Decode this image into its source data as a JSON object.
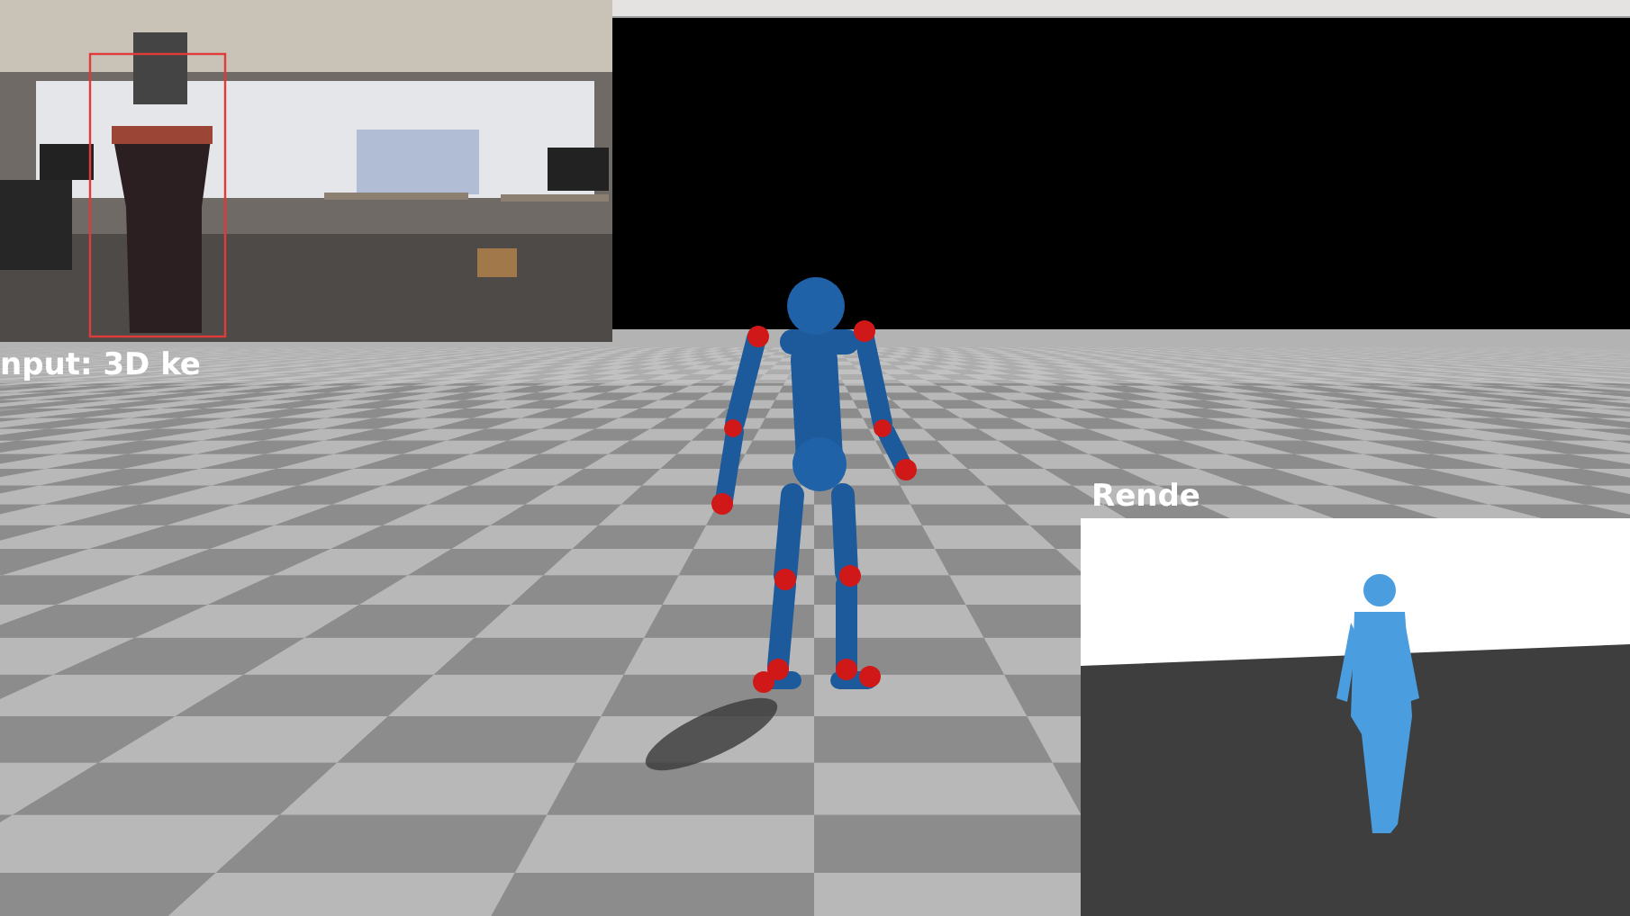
{
  "labels": [
    {
      "text": "nput: 3D ke"
    },
    {
      "text": "Rende"
    }
  ]
}
